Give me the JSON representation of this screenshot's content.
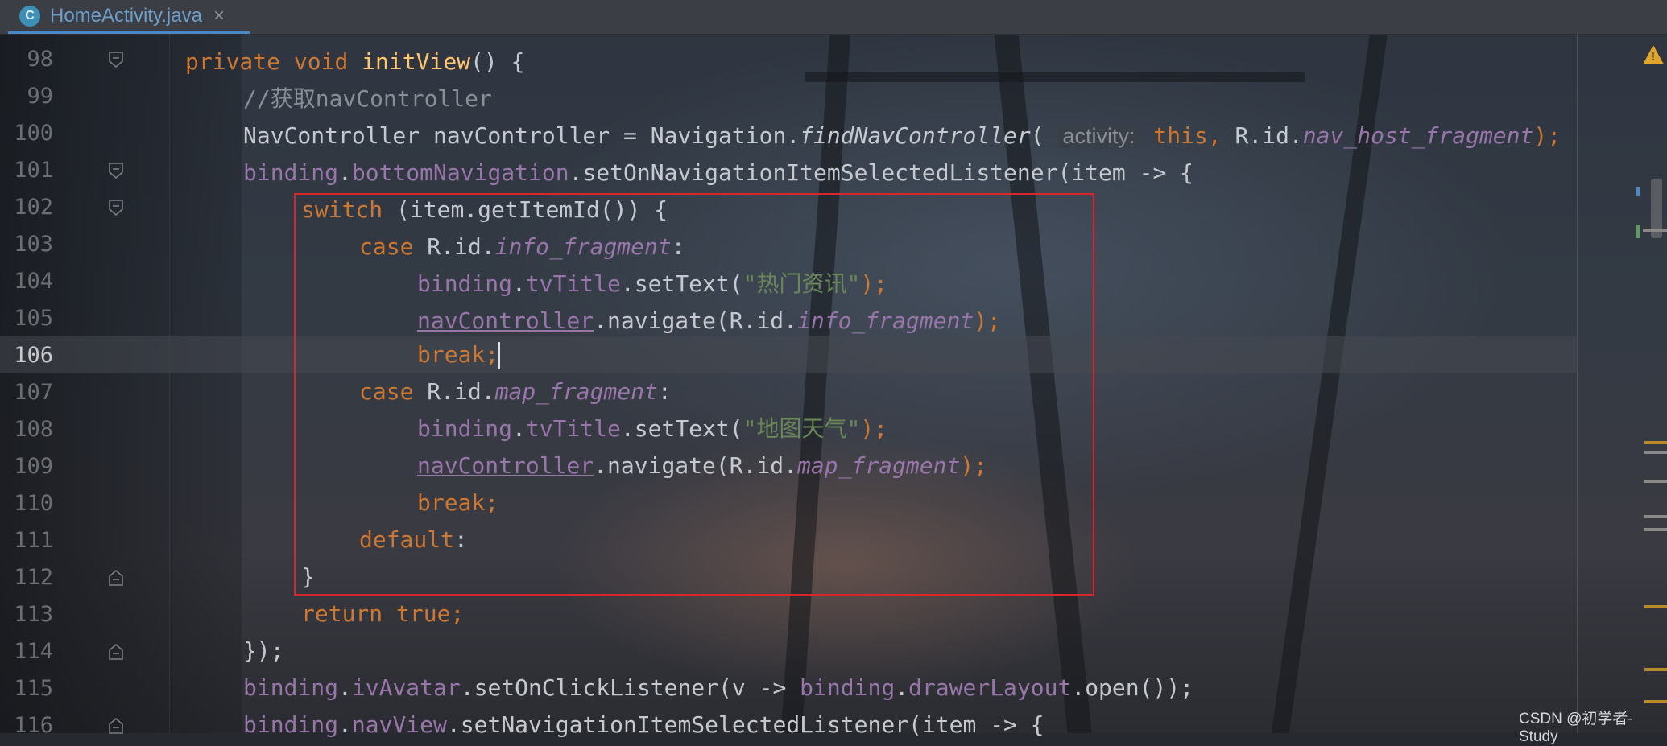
{
  "tab": {
    "icon": "C",
    "label": "HomeActivity.java",
    "close_glyph": "×"
  },
  "current_line": "106",
  "lines": [
    {
      "num": "98",
      "fold": "open"
    },
    {
      "num": "99"
    },
    {
      "num": "100"
    },
    {
      "num": "101",
      "fold": "open"
    },
    {
      "num": "102",
      "fold": "open"
    },
    {
      "num": "103"
    },
    {
      "num": "104"
    },
    {
      "num": "105"
    },
    {
      "num": "106"
    },
    {
      "num": "107"
    },
    {
      "num": "108"
    },
    {
      "num": "109"
    },
    {
      "num": "110"
    },
    {
      "num": "111"
    },
    {
      "num": "112",
      "fold": "close"
    },
    {
      "num": "113"
    },
    {
      "num": "114",
      "fold": "close"
    },
    {
      "num": "115"
    },
    {
      "num": "116",
      "fold": "close"
    }
  ],
  "code": {
    "l98": {
      "kw_private": "private",
      "kw_void": "void",
      "method": "initView",
      "rest": "() {"
    },
    "l99": {
      "comment": "//获取navController"
    },
    "l100": {
      "type": "NavController navController = Navigation.",
      "call": "findNavController",
      "paren": "( ",
      "hint": "activity:",
      "kw_this": " this,",
      "rid": " R.id.",
      "field": "nav_host_fragment",
      "end": ");"
    },
    "l101": {
      "f1": "binding",
      "dot1": ".",
      "f2": "bottomNavigation",
      "rest": ".setOnNavigationItemSelectedListener(item -> {"
    },
    "l102": {
      "kw": "switch",
      "rest": " (item.getItemId()) {"
    },
    "l103": {
      "kw": "case",
      "rid": " R.id.",
      "field": "info_fragment",
      "colon": ":"
    },
    "l104": {
      "f1": "binding",
      "dot1": ".",
      "f2": "tvTitle",
      "call": ".setText(",
      "str": "\"热门资讯\"",
      "end": ");"
    },
    "l105": {
      "ul": "navController",
      "call": ".navigate(R.id.",
      "field": "info_fragment",
      "end": ");"
    },
    "l106": {
      "kw": "break;"
    },
    "l107": {
      "kw": "case",
      "rid": " R.id.",
      "field": "map_fragment",
      "colon": ":"
    },
    "l108": {
      "f1": "binding",
      "dot1": ".",
      "f2": "tvTitle",
      "call": ".setText(",
      "str": "\"地图天气\"",
      "end": ");"
    },
    "l109": {
      "ul": "navController",
      "call": ".navigate(R.id.",
      "field": "map_fragment",
      "end": ");"
    },
    "l110": {
      "kw": "break;"
    },
    "l111": {
      "kw": "default",
      "colon": ":"
    },
    "l112": {
      "brace": "}"
    },
    "l113": {
      "kw_return": "return",
      "kw_true": " true;"
    },
    "l114": {
      "brace": "});"
    },
    "l115": {
      "f1": "binding",
      "dot1": ".",
      "f2": "ivAvatar",
      "mid": ".setOnClickListener(v -> ",
      "f3": "binding",
      "dot2": ".",
      "f4": "drawerLayout",
      "end": ".open());"
    },
    "l116": {
      "f1": "binding",
      "dot1": ".",
      "f2": "navView",
      "rest": ".setNavigationItemSelectedListener(item -> {"
    }
  },
  "watermark": "CSDN @初学者-Study",
  "colors": {
    "keyword": "#cc7832",
    "method": "#ffc66d",
    "field": "#9876aa",
    "string": "#6a8759",
    "highlight_box": "#d9262a",
    "warning": "#e0a52a"
  },
  "icons": [
    "class-file-icon",
    "close-icon",
    "fold-marker-icon",
    "warning-icon"
  ]
}
